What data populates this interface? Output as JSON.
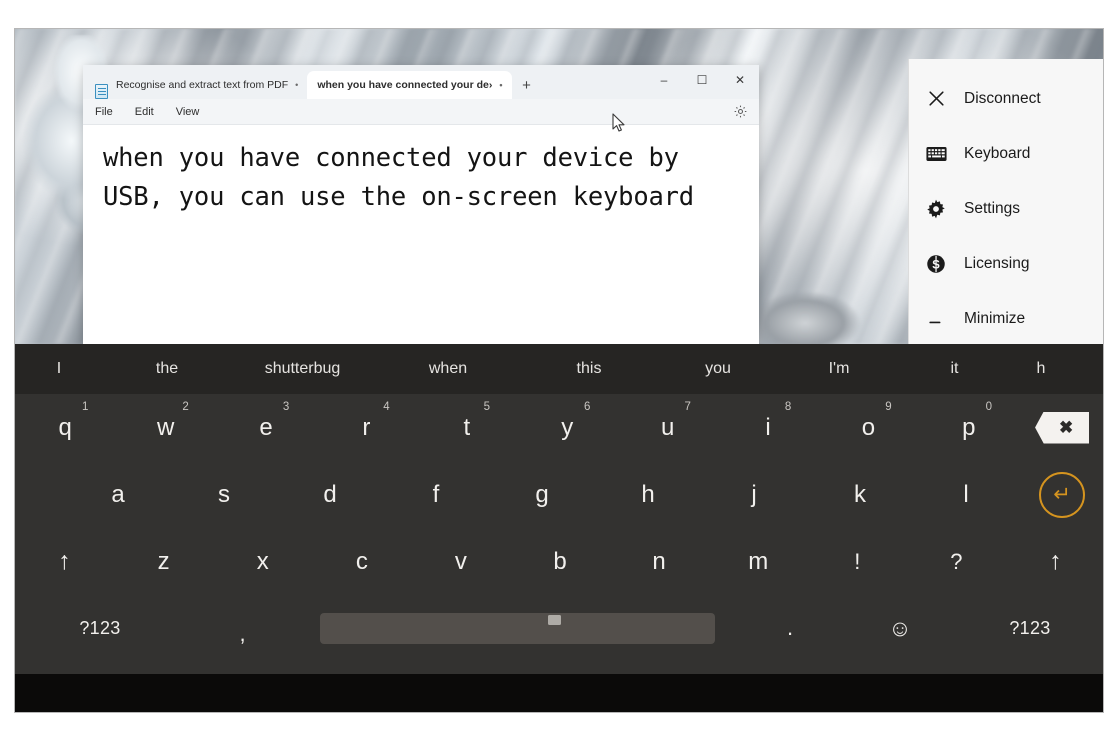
{
  "app_window": {
    "tabs": [
      {
        "label": "Recognise and extract text from PDF",
        "dot": "•",
        "active": false
      },
      {
        "label": "when you have connected your de›",
        "dot": "•",
        "active": true
      }
    ],
    "new_tab_label": "+",
    "window_controls": {
      "minimize": "–",
      "maximize": "☐",
      "close": "✕"
    },
    "menu_bar": [
      "File",
      "Edit",
      "View"
    ],
    "settings_icon": "gear-icon",
    "document_text": "when you have connected your device by USB, you can use the on-screen keyboard"
  },
  "side_menu": {
    "items": [
      {
        "icon": "close-icon",
        "glyph": "✕",
        "label": "Disconnect"
      },
      {
        "icon": "keyboard-icon",
        "glyph": "⌨",
        "label": "Keyboard"
      },
      {
        "icon": "gear-icon",
        "glyph": "⚙",
        "label": "Settings"
      },
      {
        "icon": "dollar-badge-icon",
        "glyph": "Ⓙ",
        "label": "Licensing"
      },
      {
        "icon": "minimize-icon",
        "glyph": "—",
        "label": "Minimize"
      }
    ]
  },
  "keyboard": {
    "suggestions": [
      "I",
      "the",
      "shutterbug",
      "when",
      "this",
      "you",
      "I'm",
      "it",
      "h"
    ],
    "row1": [
      {
        "key": "q",
        "sup": "1"
      },
      {
        "key": "w",
        "sup": "2"
      },
      {
        "key": "e",
        "sup": "3"
      },
      {
        "key": "r",
        "sup": "4"
      },
      {
        "key": "t",
        "sup": "5"
      },
      {
        "key": "y",
        "sup": "6"
      },
      {
        "key": "u",
        "sup": "7"
      },
      {
        "key": "i",
        "sup": "8"
      },
      {
        "key": "o",
        "sup": "9"
      },
      {
        "key": "p",
        "sup": "0"
      }
    ],
    "backspace_glyph": "✖",
    "row2": [
      "a",
      "s",
      "d",
      "f",
      "g",
      "h",
      "j",
      "k",
      "l"
    ],
    "enter_glyph": "↵",
    "row3": [
      "↑",
      "z",
      "x",
      "c",
      "v",
      "b",
      "n",
      "m",
      "!",
      "?",
      "↑"
    ],
    "row4": {
      "symbols_left": "?123",
      "comma": ",",
      "switch_icon": "keyboard-switch-icon",
      "space": "",
      "period": ".",
      "emoji": "☺",
      "symbols_right": "?123"
    }
  },
  "colors": {
    "keyboard_bg": "#333230",
    "suggestion_bg": "#262523",
    "enter_accent": "#d5941f",
    "space_key": "#534f4b",
    "nav_bar": "#0b0a09",
    "panel_bg": "#f7f7f7"
  }
}
